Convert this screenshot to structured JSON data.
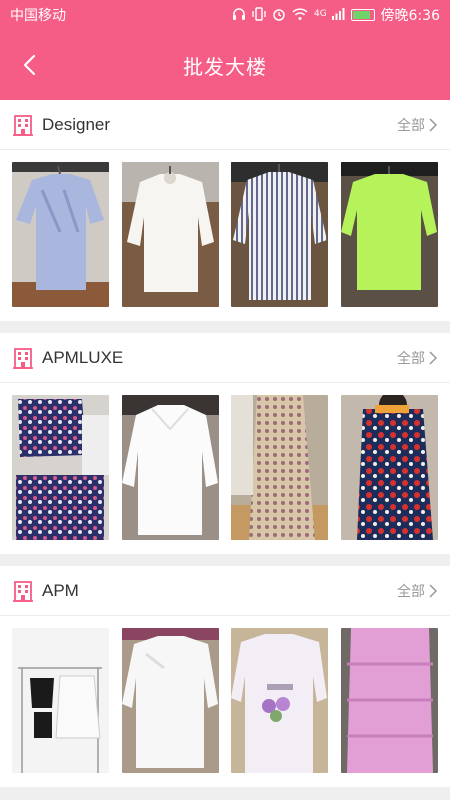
{
  "status": {
    "carrier": "中国移动",
    "network": "4G",
    "time": "傍晚6:36"
  },
  "nav": {
    "title": "批发大楼"
  },
  "sections": [
    {
      "title": "Designer",
      "all_label": "全部"
    },
    {
      "title": "APMLUXE",
      "all_label": "全部"
    },
    {
      "title": "APM",
      "all_label": "全部"
    }
  ],
  "colors": {
    "accent": "#f65d86",
    "icon": "#f65d86"
  }
}
